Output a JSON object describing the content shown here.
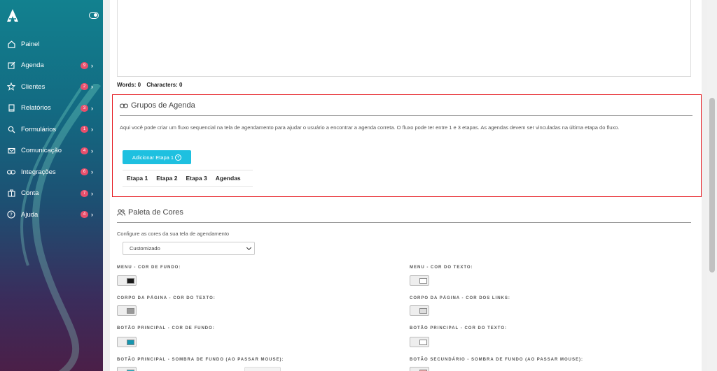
{
  "sidebar": {
    "items": [
      {
        "label": "Painel",
        "icon": "home-icon",
        "badge": ""
      },
      {
        "label": "Agenda",
        "icon": "edit-icon",
        "badge": "9"
      },
      {
        "label": "Clientes",
        "icon": "star-icon",
        "badge": "2"
      },
      {
        "label": "Relatórios",
        "icon": "book-icon",
        "badge": "3"
      },
      {
        "label": "Formulários",
        "icon": "search-icon",
        "badge": "1"
      },
      {
        "label": "Comunicação",
        "icon": "mail-icon",
        "badge": "4"
      },
      {
        "label": "Integrações",
        "icon": "link-icon",
        "badge": "6"
      },
      {
        "label": "Conta",
        "icon": "briefcase-icon",
        "badge": "7"
      },
      {
        "label": "Ajuda",
        "icon": "help-icon",
        "badge": "4"
      }
    ]
  },
  "editor": {
    "words_label": "Words: 0",
    "characters_label": "Characters: 0"
  },
  "agenda_groups": {
    "title": "Grupos de Agenda",
    "description": "Aqui você pode criar um fluxo sequencial na tela de agendamento para ajudar o usuário a encontrar a agenda correta. O fluxo pode ter entre 1 e 3 etapas. As agendas devem ser vinculadas na última etapa do fluxo.",
    "add_button": "Adicionar Etapa 1",
    "columns": [
      "Etapa 1",
      "Etapa 2",
      "Etapa 3",
      "Agendas"
    ]
  },
  "palette": {
    "title": "Paleta de Cores",
    "config_label": "Configure as cores da sua tela de agendamento",
    "select_value": "Customizado",
    "fields": [
      {
        "label": "MENU - COR DE FUNDO:",
        "color": "#1a1a1a"
      },
      {
        "label": "MENU - COR DO TEXTO:",
        "color": "#ffffff"
      },
      {
        "label": "CORPO DA PÁGINA - COR DO TEXTO:",
        "color": "#999999"
      },
      {
        "label": "CORPO DA PÁGINA - COR DOS LINKS:",
        "color": "#dddddd"
      },
      {
        "label": "BOTÃO PRINCIPAL - COR DE FUNDO:",
        "color": "#1696b0"
      },
      {
        "label": "BOTÃO PRINCIPAL - COR DO TEXTO:",
        "color": "#ffffff"
      },
      {
        "label": "BOTÃO PRINCIPAL - SOMBRA DE FUNDO (AO PASSAR MOUSE):",
        "color": "#1fb1c8"
      },
      {
        "label": "BOTÃO SECUNDÁRIO - SOMBRA DE FUNDO (AO PASSAR MOUSE):",
        "color": "#e8a0a0"
      }
    ]
  },
  "colors": {
    "badge": "#e84f6c",
    "primary_button": "#1ec0e0",
    "highlight_border": "#e5161d"
  }
}
